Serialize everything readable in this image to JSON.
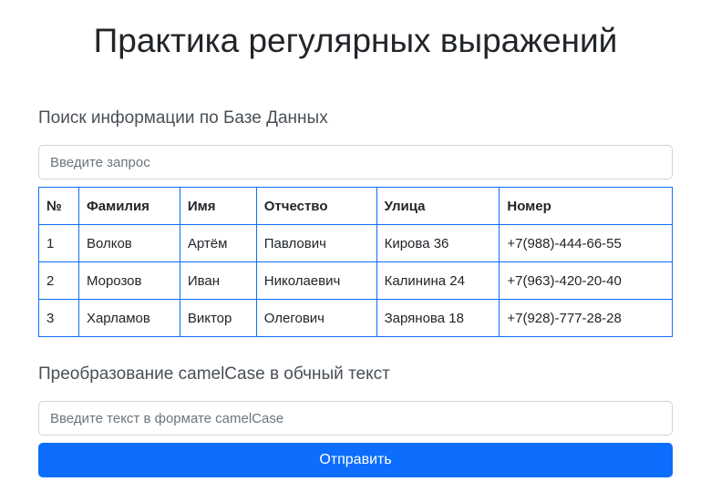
{
  "page": {
    "title": "Практика регулярных выражений"
  },
  "search_section": {
    "title": "Поиск информации по Базе Данных",
    "placeholder": "Введите запрос"
  },
  "table": {
    "headers": [
      "№",
      "Фамилия",
      "Имя",
      "Отчество",
      "Улица",
      "Номер"
    ],
    "rows": [
      [
        "1",
        "Волков",
        "Артём",
        "Павлович",
        "Кирова 36",
        "+7(988)-444-66-55"
      ],
      [
        "2",
        "Морозов",
        "Иван",
        "Николаевич",
        "Калинина 24",
        "+7(963)-420-20-40"
      ],
      [
        "3",
        "Харламов",
        "Виктор",
        "Олегович",
        "Зарянова 18",
        "+7(928)-777-28-28"
      ]
    ]
  },
  "camel_section": {
    "title": "Преобразование camelCase в обчный текст",
    "placeholder": "Введите текст в формате camelCase",
    "submit_label": "Отправить"
  },
  "colors": {
    "accent": "#0d6efd",
    "text": "#212529",
    "input_border": "#ced4da",
    "placeholder": "#6c757d"
  }
}
